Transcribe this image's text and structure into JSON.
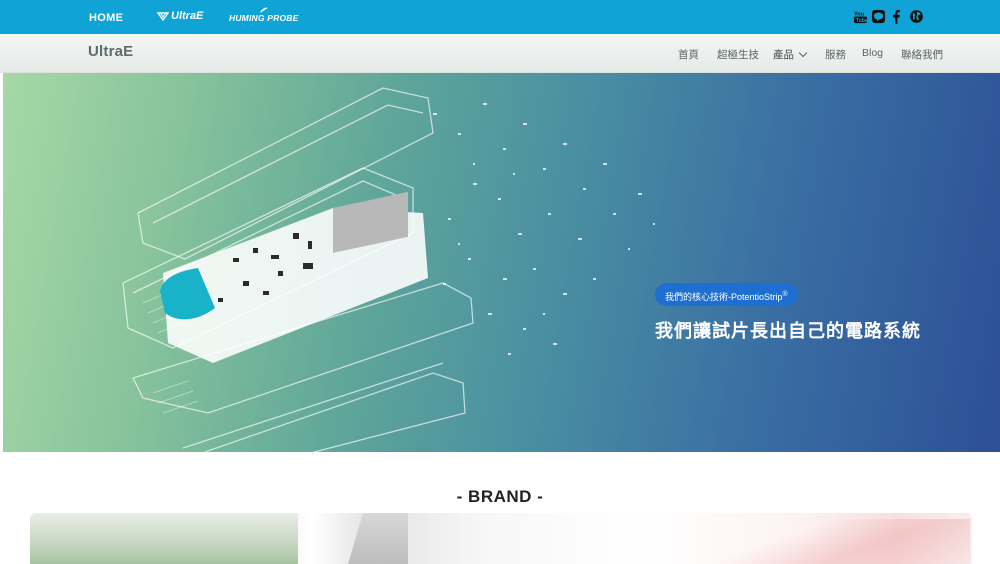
{
  "topbar": {
    "home_label": "HOME",
    "brand1_label": "UltraE",
    "brand2_label": "HUMING PROBE",
    "social_icons": [
      "youtube-icon",
      "line-icon",
      "facebook-icon",
      "globe-icon"
    ],
    "accent": "#0fa3d6"
  },
  "navbar": {
    "logo": "UltraE",
    "items": [
      {
        "label": "首頁"
      },
      {
        "label": "超極生技"
      },
      {
        "label": "產品"
      },
      {
        "label": "服務"
      },
      {
        "label": "Blog"
      },
      {
        "label": "聯絡我們"
      }
    ]
  },
  "hero": {
    "badge": "我們的核心技術-PotentioStrip",
    "badge_mark": "®",
    "title": "我們讓試片長出自己的電路系統",
    "badge_color": "#1e6fd1"
  },
  "brand_section": {
    "title": "- BRAND -"
  }
}
